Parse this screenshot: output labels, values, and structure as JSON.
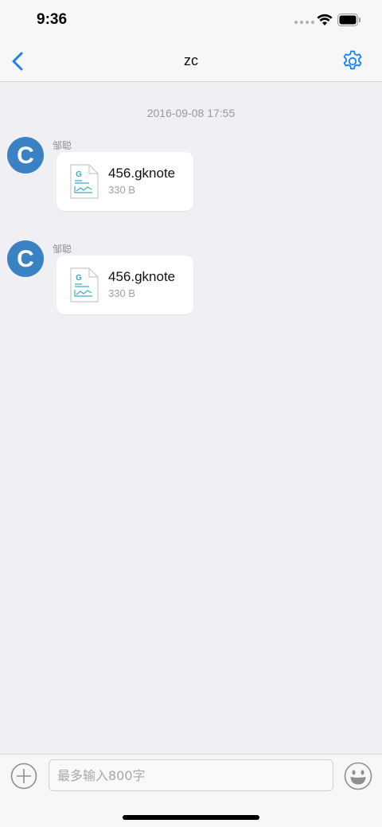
{
  "status_bar": {
    "time": "9:36"
  },
  "nav": {
    "title": "zc"
  },
  "conversation": {
    "timestamp": "2016-09-08 17:55",
    "messages": [
      {
        "sender": "邹聪",
        "avatar_letter": "C",
        "file_name": "456.gknote",
        "file_size": "330 B",
        "file_icon_letter": "G"
      },
      {
        "sender": "邹聪",
        "avatar_letter": "C",
        "file_name": "456.gknote",
        "file_size": "330 B",
        "file_icon_letter": "G"
      }
    ]
  },
  "input_bar": {
    "placeholder": "最多输入800字",
    "value": ""
  },
  "colors": {
    "accent": "#1a82f0",
    "avatar": "#3b82c4",
    "file_icon": "#3fa8c9"
  }
}
